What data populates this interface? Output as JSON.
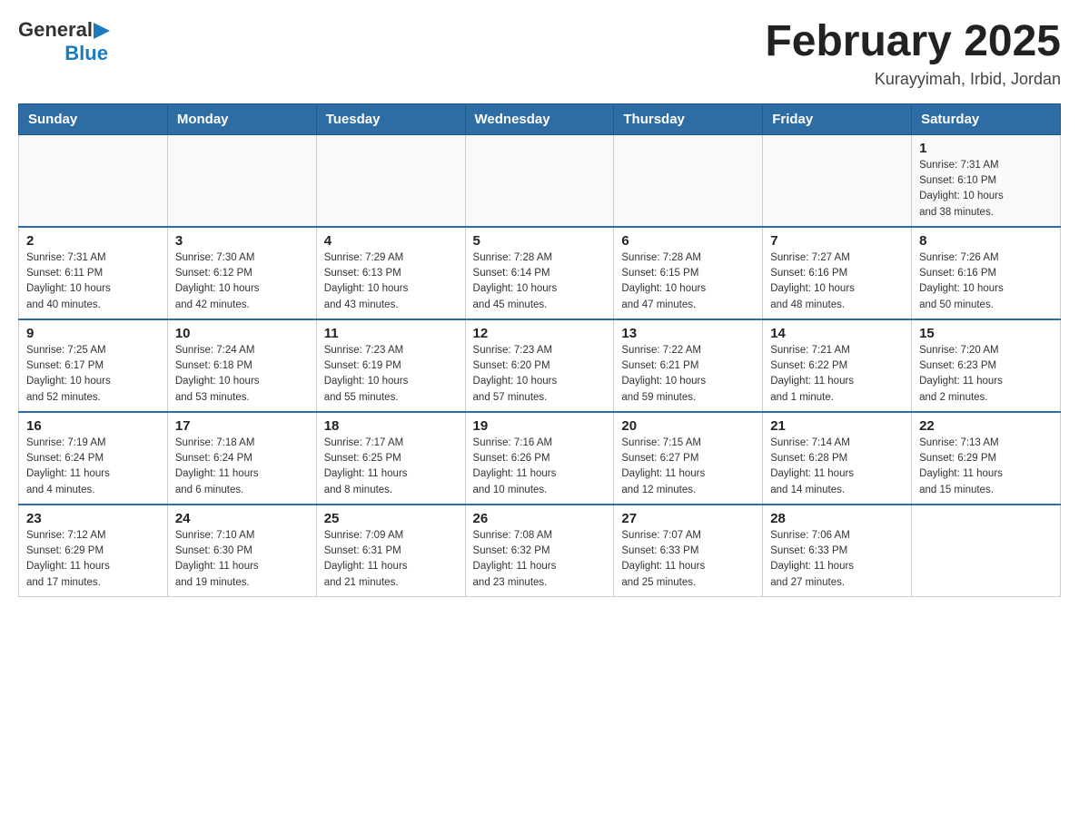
{
  "header": {
    "logo": {
      "general": "General",
      "arrow": "▶",
      "blue": "Blue"
    },
    "title": "February 2025",
    "subtitle": "Kurayyimah, Irbid, Jordan"
  },
  "days_of_week": [
    "Sunday",
    "Monday",
    "Tuesday",
    "Wednesday",
    "Thursday",
    "Friday",
    "Saturday"
  ],
  "weeks": [
    {
      "days": [
        {
          "date": "",
          "info": ""
        },
        {
          "date": "",
          "info": ""
        },
        {
          "date": "",
          "info": ""
        },
        {
          "date": "",
          "info": ""
        },
        {
          "date": "",
          "info": ""
        },
        {
          "date": "",
          "info": ""
        },
        {
          "date": "1",
          "info": "Sunrise: 7:31 AM\nSunset: 6:10 PM\nDaylight: 10 hours\nand 38 minutes."
        }
      ]
    },
    {
      "days": [
        {
          "date": "2",
          "info": "Sunrise: 7:31 AM\nSunset: 6:11 PM\nDaylight: 10 hours\nand 40 minutes."
        },
        {
          "date": "3",
          "info": "Sunrise: 7:30 AM\nSunset: 6:12 PM\nDaylight: 10 hours\nand 42 minutes."
        },
        {
          "date": "4",
          "info": "Sunrise: 7:29 AM\nSunset: 6:13 PM\nDaylight: 10 hours\nand 43 minutes."
        },
        {
          "date": "5",
          "info": "Sunrise: 7:28 AM\nSunset: 6:14 PM\nDaylight: 10 hours\nand 45 minutes."
        },
        {
          "date": "6",
          "info": "Sunrise: 7:28 AM\nSunset: 6:15 PM\nDaylight: 10 hours\nand 47 minutes."
        },
        {
          "date": "7",
          "info": "Sunrise: 7:27 AM\nSunset: 6:16 PM\nDaylight: 10 hours\nand 48 minutes."
        },
        {
          "date": "8",
          "info": "Sunrise: 7:26 AM\nSunset: 6:16 PM\nDaylight: 10 hours\nand 50 minutes."
        }
      ]
    },
    {
      "days": [
        {
          "date": "9",
          "info": "Sunrise: 7:25 AM\nSunset: 6:17 PM\nDaylight: 10 hours\nand 52 minutes."
        },
        {
          "date": "10",
          "info": "Sunrise: 7:24 AM\nSunset: 6:18 PM\nDaylight: 10 hours\nand 53 minutes."
        },
        {
          "date": "11",
          "info": "Sunrise: 7:23 AM\nSunset: 6:19 PM\nDaylight: 10 hours\nand 55 minutes."
        },
        {
          "date": "12",
          "info": "Sunrise: 7:23 AM\nSunset: 6:20 PM\nDaylight: 10 hours\nand 57 minutes."
        },
        {
          "date": "13",
          "info": "Sunrise: 7:22 AM\nSunset: 6:21 PM\nDaylight: 10 hours\nand 59 minutes."
        },
        {
          "date": "14",
          "info": "Sunrise: 7:21 AM\nSunset: 6:22 PM\nDaylight: 11 hours\nand 1 minute."
        },
        {
          "date": "15",
          "info": "Sunrise: 7:20 AM\nSunset: 6:23 PM\nDaylight: 11 hours\nand 2 minutes."
        }
      ]
    },
    {
      "days": [
        {
          "date": "16",
          "info": "Sunrise: 7:19 AM\nSunset: 6:24 PM\nDaylight: 11 hours\nand 4 minutes."
        },
        {
          "date": "17",
          "info": "Sunrise: 7:18 AM\nSunset: 6:24 PM\nDaylight: 11 hours\nand 6 minutes."
        },
        {
          "date": "18",
          "info": "Sunrise: 7:17 AM\nSunset: 6:25 PM\nDaylight: 11 hours\nand 8 minutes."
        },
        {
          "date": "19",
          "info": "Sunrise: 7:16 AM\nSunset: 6:26 PM\nDaylight: 11 hours\nand 10 minutes."
        },
        {
          "date": "20",
          "info": "Sunrise: 7:15 AM\nSunset: 6:27 PM\nDaylight: 11 hours\nand 12 minutes."
        },
        {
          "date": "21",
          "info": "Sunrise: 7:14 AM\nSunset: 6:28 PM\nDaylight: 11 hours\nand 14 minutes."
        },
        {
          "date": "22",
          "info": "Sunrise: 7:13 AM\nSunset: 6:29 PM\nDaylight: 11 hours\nand 15 minutes."
        }
      ]
    },
    {
      "days": [
        {
          "date": "23",
          "info": "Sunrise: 7:12 AM\nSunset: 6:29 PM\nDaylight: 11 hours\nand 17 minutes."
        },
        {
          "date": "24",
          "info": "Sunrise: 7:10 AM\nSunset: 6:30 PM\nDaylight: 11 hours\nand 19 minutes."
        },
        {
          "date": "25",
          "info": "Sunrise: 7:09 AM\nSunset: 6:31 PM\nDaylight: 11 hours\nand 21 minutes."
        },
        {
          "date": "26",
          "info": "Sunrise: 7:08 AM\nSunset: 6:32 PM\nDaylight: 11 hours\nand 23 minutes."
        },
        {
          "date": "27",
          "info": "Sunrise: 7:07 AM\nSunset: 6:33 PM\nDaylight: 11 hours\nand 25 minutes."
        },
        {
          "date": "28",
          "info": "Sunrise: 7:06 AM\nSunset: 6:33 PM\nDaylight: 11 hours\nand 27 minutes."
        },
        {
          "date": "",
          "info": ""
        }
      ]
    }
  ]
}
